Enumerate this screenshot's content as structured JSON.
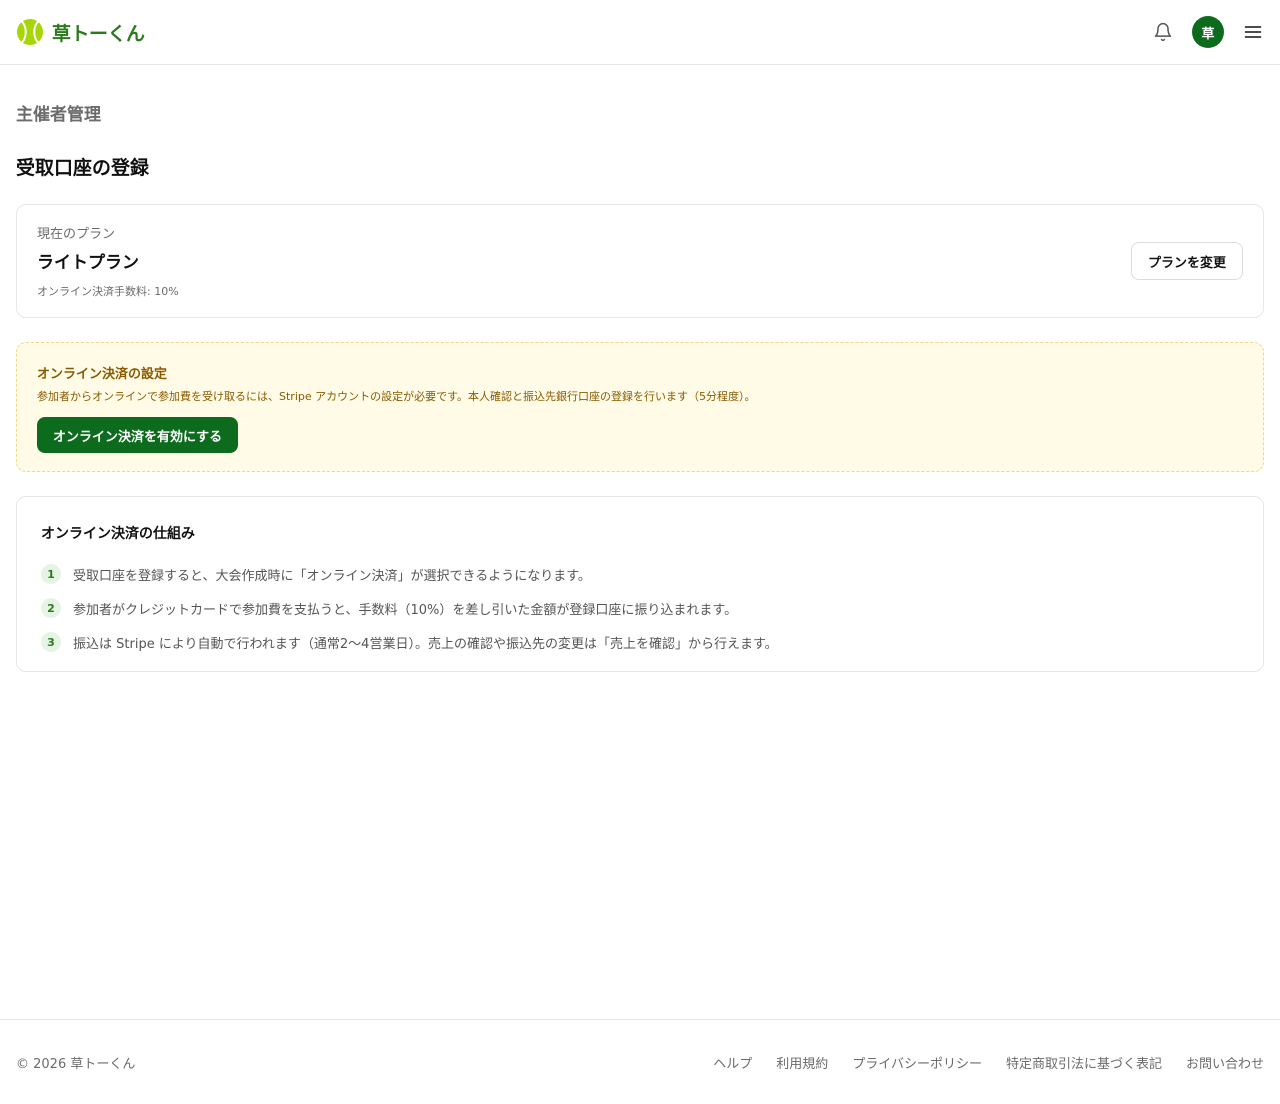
{
  "header": {
    "logo_text": "草トーくん",
    "avatar_initial": "草",
    "icons": {
      "logo": "tennis-ball-icon",
      "notifications": "bell-icon",
      "menu": "hamburger-menu-icon"
    },
    "brand_color": "#0d6b1e"
  },
  "main": {
    "section_label": "主催者管理",
    "page_title": "受取口座の登録",
    "plan": {
      "caption": "現在のプラン",
      "name": "ライトプラン",
      "fee": "オンライン決済手数料: 10%",
      "change_button": "プランを変更"
    },
    "notice": {
      "title": "オンライン決済の設定",
      "description": "参加者からオンラインで参加費を受け取るには、Stripe アカウントの設定が必要です。本人確認と振込先銀行口座の登録を行います（5分程度）。",
      "enable_button": "オンライン決済を有効にする"
    },
    "how_it_works": {
      "title": "オンライン決済の仕組み",
      "steps": [
        {
          "num": "1",
          "text": "受取口座を登録すると、大会作成時に「オンライン決済」が選択できるようになります。"
        },
        {
          "num": "2",
          "text": "参加者がクレジットカードで参加費を支払うと、手数料（10%）を差し引いた金額が登録口座に振り込まれます。"
        },
        {
          "num": "3",
          "text": "振込は Stripe により自動で行われます（通常2〜4営業日）。売上の確認や振込先の変更は「売上を確認」から行えます。"
        }
      ]
    }
  },
  "footer": {
    "copyright": "© 2026 草トーくん",
    "links": [
      "ヘルプ",
      "利用規約",
      "プライバシーポリシー",
      "特定商取引法に基づく表記",
      "お問い合わせ"
    ]
  }
}
